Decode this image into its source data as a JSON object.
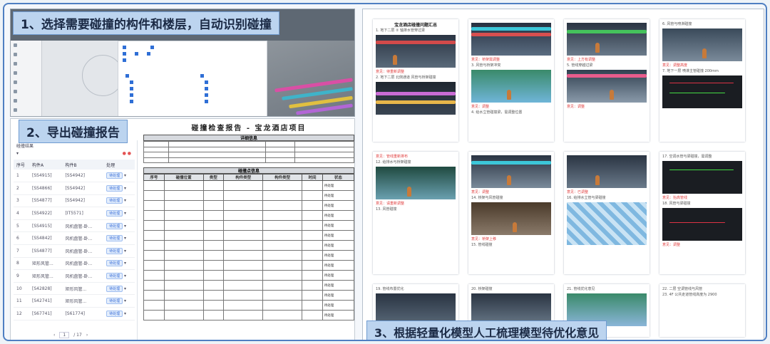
{
  "step1": {
    "title": "1、选择需要碰撞的构件和楼层，自动识别碰撞"
  },
  "step2": {
    "title": "2、导出碰撞报告"
  },
  "step3": {
    "title": "3、根据轻量化模型人工梳理模型待优化意见"
  },
  "report": {
    "title": "碰撞检查报告 - 宝龙酒店项目",
    "section_detail": "详细信息",
    "section_points": "碰撞点信息",
    "columns": [
      "序号",
      "碰撞位置",
      "类型",
      "构件类型",
      "构件类型",
      "时间",
      "状态"
    ],
    "status": "待处理"
  },
  "list": {
    "header": "碰撞结果",
    "col_index": "序号",
    "col_a": "构件A",
    "col_b": "构件B",
    "col_status": "处理",
    "rows": [
      {
        "no": "1",
        "a": "[SS4915]",
        "b": "[SS4942]"
      },
      {
        "no": "2",
        "a": "[SS4866]",
        "b": "[SS4942]"
      },
      {
        "no": "3",
        "a": "[SS4877]",
        "b": "[SS4942]"
      },
      {
        "no": "4",
        "a": "[SS4922]",
        "b": "[IT5571]"
      },
      {
        "no": "5",
        "a": "[SS4915]",
        "b": "风机盘管-卧..."
      },
      {
        "no": "6",
        "a": "[SS4842]",
        "b": "风机盘管-卧..."
      },
      {
        "no": "7",
        "a": "[SS4877]",
        "b": "风机盘管-卧..."
      },
      {
        "no": "8",
        "a": "矩形风管...",
        "b": "风机盘管-卧..."
      },
      {
        "no": "9",
        "a": "矩形风管...",
        "b": "风机盘管-卧..."
      },
      {
        "no": "10",
        "a": "[S42828]",
        "b": "矩形风管..."
      },
      {
        "no": "11",
        "a": "[S42741]",
        "b": "矩形风管..."
      },
      {
        "no": "12",
        "a": "[S67741]",
        "b": "[S61774]"
      }
    ],
    "badge": "待处理",
    "page_current": "1",
    "page_total": "/ 17"
  },
  "pages": {
    "p1_title": "宝龙酒店碰撞问题汇总",
    "p1_item": "1. 地下二层 ② 轴排水管穿过梁",
    "p1_note": "意见：待重新调整",
    "p1_item2": "2. 地下二层 北侧通道 风管与桥架碰撞",
    "p2_note": "意见：桥架需调整",
    "p2_item": "3. 风管与桥架冲突",
    "p2_note2": "意见：调整",
    "p2_item2": "4. 给水立管碰撞梁，需调整位置",
    "p3_note": "意见：上方有调整",
    "p3_item": "5. 管线穿越过梁",
    "p3_note2": "意见：调整",
    "p4_item": "6. 风管与喷淋碰撞",
    "p4_note": "意见：调整高度",
    "p4_item2": "7. 地下一层 喷淋主管碰撞 200mm",
    "p5_note": "意见：管线重新排布",
    "p5_item": "12. 给排水与桥架碰撞",
    "p5_note2": "意见：请重新调整",
    "p5_item2": "13. 风管碰撞",
    "p6_note": "意见：调整",
    "p6_item": "14. 桥架与风管碰撞",
    "p6_note2": "意见：桥架上移",
    "p6_item2": "15. 管线碰撞",
    "p7_item": "16. 给排水立管与梁碰撞",
    "p7_note": "意见：已调整",
    "p8_item": "17. 空调水管与梁碰撞，需调整",
    "p8_note": "意见：抬高管线",
    "p8_item2": "18. 风管与梁碰撞",
    "p8_note2": "意见：调整",
    "p9_item": "19. 管线布置优化",
    "p10_item": "20. 桥架碰撞",
    "p11_item": "21. 管线优化意见",
    "p12_item": "22. 二层 空调管线与风管",
    "p12_item2": "23. 4F 公共走道管线高度为 2900"
  },
  "colors": {
    "accent": "#2f6fd6",
    "title_bg": "#bcd4ef",
    "warn": "#e03c3c"
  }
}
